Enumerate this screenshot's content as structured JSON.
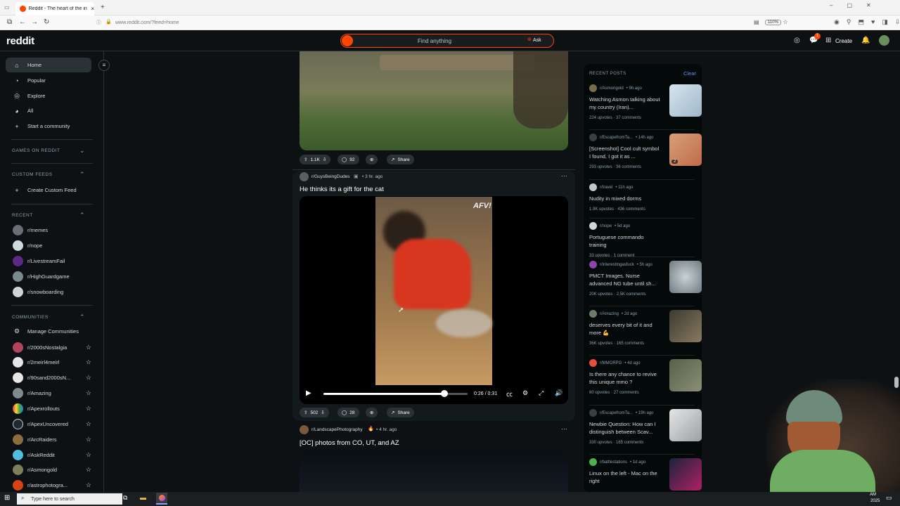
{
  "browser": {
    "tab_title": "Reddit - The heart of the in",
    "new_tab": "+",
    "url": "www.reddit.com/?feed=home",
    "zoom": "110%"
  },
  "header": {
    "logo": "reddit",
    "search_placeholder": "Find anything",
    "ask_label": "Ask",
    "create_label": "Create",
    "notification_badge": "1"
  },
  "sidebar": {
    "nav": [
      {
        "label": "Home",
        "icon": "home-icon"
      },
      {
        "label": "Popular",
        "icon": "popular-icon"
      },
      {
        "label": "Explore",
        "icon": "explore-icon"
      },
      {
        "label": "All",
        "icon": "all-icon"
      },
      {
        "label": "Start a community",
        "icon": "plus-icon"
      }
    ],
    "games_header": "GAMES ON REDDIT",
    "custom_feeds_header": "CUSTOM FEEDS",
    "create_custom_feed": "Create Custom Feed",
    "recent_header": "RECENT",
    "recent": [
      "r/memes",
      "r/nope",
      "r/LivestreamFail",
      "r/HighGuardgame",
      "r/snowboarding"
    ],
    "communities_header": "COMMUNITIES",
    "manage_communities": "Manage Communities",
    "communities": [
      "r/2000sNostalgia",
      "r/2meirl4meirl",
      "r/90sand2000sN...",
      "r/Amazing",
      "r/Apexrollouts",
      "r/ApexUncovered",
      "r/ArcRaiders",
      "r/AskReddit",
      "r/Asmongold",
      "r/astrophotogra..."
    ]
  },
  "feed": {
    "post1": {
      "upvotes": "1.1K",
      "comments": "92",
      "share": "Share"
    },
    "post2": {
      "subreddit": "r/GuysBeingDudes",
      "time": "• 3 hr. ago",
      "title": "He thinks its a gift for the cat",
      "watermark": "AFV!",
      "time_display": "0:26 / 0:31",
      "progress": 0.84,
      "upvotes": "502",
      "comments": "28",
      "share": "Share"
    },
    "post3": {
      "subreddit": "r/LandscapePhotography",
      "time": "• 4 hr. ago",
      "title": "[OC] photos from CO, UT, and AZ"
    }
  },
  "recent_posts": {
    "header": "RECENT POSTS",
    "clear": "Clear",
    "items": [
      {
        "sub": "r/Asmongold",
        "time": "• 9h ago",
        "title": "Watching Asmon talking about my country (Iran)...",
        "meta": "224 upvotes  ·  37 comments"
      },
      {
        "sub": "r/EscapefromTa...",
        "time": "• 14h ago",
        "title": "[Screenshot] Cool cult symbol I found, I got it as ...",
        "meta": "293 upvotes  ·  36 comments",
        "badge": "2"
      },
      {
        "sub": "r/travel",
        "time": "• 11h ago",
        "title": "Nudity in mixed dorms",
        "meta": "1.9K upvotes  ·  436 comments"
      },
      {
        "sub": "r/nope",
        "time": "• 5d ago",
        "title": "Portuguese commando training",
        "meta": "33 upvotes  ·  1 comment"
      },
      {
        "sub": "r/interestingasfuck",
        "time": "• 5h ago",
        "title": "PMCT Images. Nurse advanced NG tube until sh...",
        "meta": "20K upvotes  ·  2.5K comments"
      },
      {
        "sub": "r/Amazing",
        "time": "• 2d ago",
        "title": "deserves every bit of it and more 💪",
        "meta": "36K upvotes  ·  165 comments"
      },
      {
        "sub": "r/MMORPG",
        "time": "• 4d ago",
        "title": "Is there any chance to revive this unique mmo ?",
        "meta": "60 upvotes  ·  27 comments"
      },
      {
        "sub": "r/EscapefromTa...",
        "time": "• 19h ago",
        "title": "Newbie Question: How can I distinguish between Scav...",
        "meta": "330 upvotes  ·  165 comments"
      },
      {
        "sub": "r/battlestations",
        "time": "• 1d ago",
        "title": "Linux on the left - Mac on the right",
        "meta": ""
      }
    ]
  },
  "taskbar": {
    "search_placeholder": "Type here to search",
    "time": "AM",
    "year": "2025"
  }
}
